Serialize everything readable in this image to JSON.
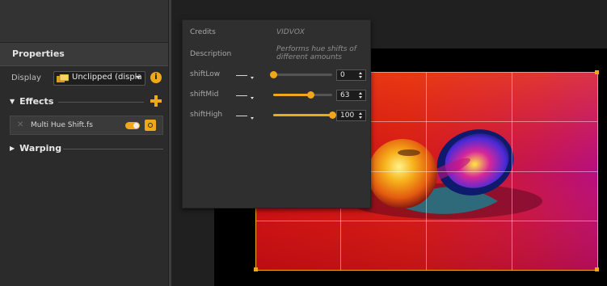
{
  "properties": {
    "title": "Properties",
    "display_label": "Display",
    "display_value": "Unclipped (displa",
    "info_icon": "info-icon",
    "effects_label": "Effects",
    "effects": [
      {
        "name": "Multi Hue Shift.fs",
        "enabled": true
      }
    ],
    "warping_label": "Warping"
  },
  "panel": {
    "credits_label": "Credits",
    "credits_value": "VIDVOX",
    "description_label": "Description",
    "description_value": "Performs hue shifts of different amounts",
    "params": [
      {
        "label": "shiftLow",
        "value": "0",
        "fraction": 0.0
      },
      {
        "label": "shiftMid",
        "value": "63",
        "fraction": 0.63
      },
      {
        "label": "shiftHigh",
        "value": "100",
        "fraction": 1.0
      }
    ]
  },
  "colors": {
    "accent": "#f0a81a",
    "panel_bg": "#2f2f2f",
    "sidebar_bg": "#2b2b2b"
  }
}
